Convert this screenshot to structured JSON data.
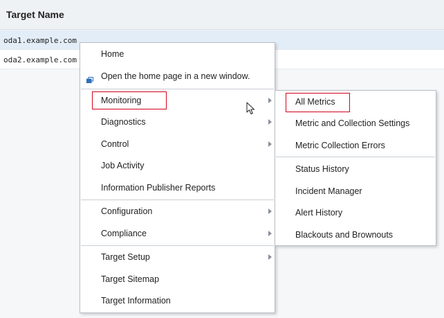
{
  "table": {
    "header": "Target Name",
    "rows": [
      {
        "name": "oda1.example.com"
      },
      {
        "name": "oda2.example.com"
      }
    ]
  },
  "context_menu": {
    "items": [
      {
        "label": "Home"
      },
      {
        "label": "Open the home page in a new window."
      },
      {
        "label": "Monitoring"
      },
      {
        "label": "Diagnostics"
      },
      {
        "label": "Control"
      },
      {
        "label": "Job Activity"
      },
      {
        "label": "Information Publisher Reports"
      },
      {
        "label": "Configuration"
      },
      {
        "label": "Compliance"
      },
      {
        "label": "Target Setup"
      },
      {
        "label": "Target Sitemap"
      },
      {
        "label": "Target Information"
      }
    ]
  },
  "submenu": {
    "items": [
      {
        "label": "All Metrics"
      },
      {
        "label": "Metric and Collection Settings"
      },
      {
        "label": "Metric Collection Errors"
      },
      {
        "label": "Status History"
      },
      {
        "label": "Incident Manager"
      },
      {
        "label": "Alert History"
      },
      {
        "label": "Blackouts and Brownouts"
      }
    ]
  },
  "colors": {
    "highlight_border": "#d0021b",
    "selected_row": "#e3edf7",
    "newwin_icon": "#2f6fb7"
  },
  "icons": {
    "newwin": "open-new-window-icon",
    "submenu_arrow": "submenu-arrow-icon",
    "cursor": "mouse-pointer-icon"
  }
}
